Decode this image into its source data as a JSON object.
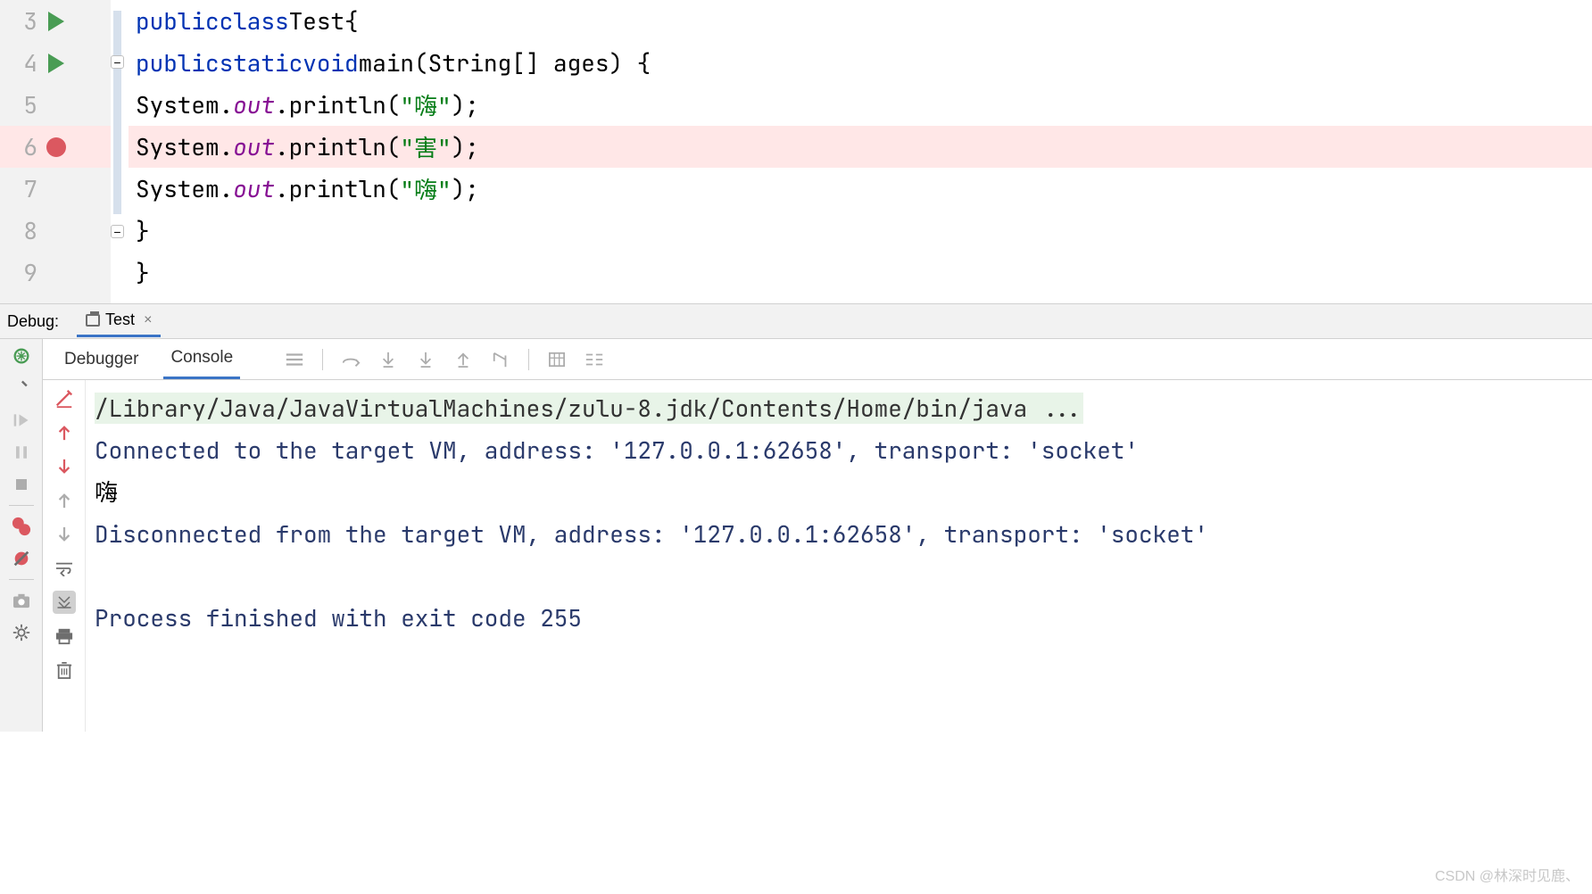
{
  "editor": {
    "lines": [
      {
        "num": "3",
        "run": true,
        "bp": false
      },
      {
        "num": "4",
        "run": true,
        "bp": false
      },
      {
        "num": "5",
        "run": false,
        "bp": false
      },
      {
        "num": "6",
        "run": false,
        "bp": true
      },
      {
        "num": "7",
        "run": false,
        "bp": false
      },
      {
        "num": "8",
        "run": false,
        "bp": false
      },
      {
        "num": "9",
        "run": false,
        "bp": false
      }
    ],
    "code": {
      "l3": {
        "kw1": "public",
        "kw2": "class",
        "cls": "Test",
        "brace": "{"
      },
      "l4": {
        "kw1": "public",
        "kw2": "static",
        "kw3": "void",
        "method": "main",
        "params": "(String[] ages) {"
      },
      "l5": {
        "obj": "System.",
        "field": "out",
        "call": ".println(",
        "str": "\"嗨\"",
        "end": ");"
      },
      "l6": {
        "obj": "System.",
        "field": "out",
        "call": ".println(",
        "str": "\"害\"",
        "end": ");"
      },
      "l7": {
        "obj": "System.",
        "field": "out",
        "call": ".println(",
        "str": "\"嗨\"",
        "end": ");"
      },
      "l8": {
        "brace": "}"
      },
      "l9": {
        "brace": "}"
      }
    }
  },
  "debugBar": {
    "label": "Debug:",
    "tabName": "Test",
    "close": "×"
  },
  "tabs": {
    "debugger": "Debugger",
    "console": "Console"
  },
  "console": {
    "cmd": "/Library/Java/JavaVirtualMachines/zulu-8.jdk/Contents/Home/bin/java ...",
    "connected": "Connected to the target VM, address: '127.0.0.1:62658', transport: 'socket'",
    "output1": "嗨",
    "disconnected": "Disconnected from the target VM, address: '127.0.0.1:62658', transport: 'socket'",
    "exit": "Process finished with exit code 255"
  },
  "watermark": "CSDN @林深时见鹿、"
}
